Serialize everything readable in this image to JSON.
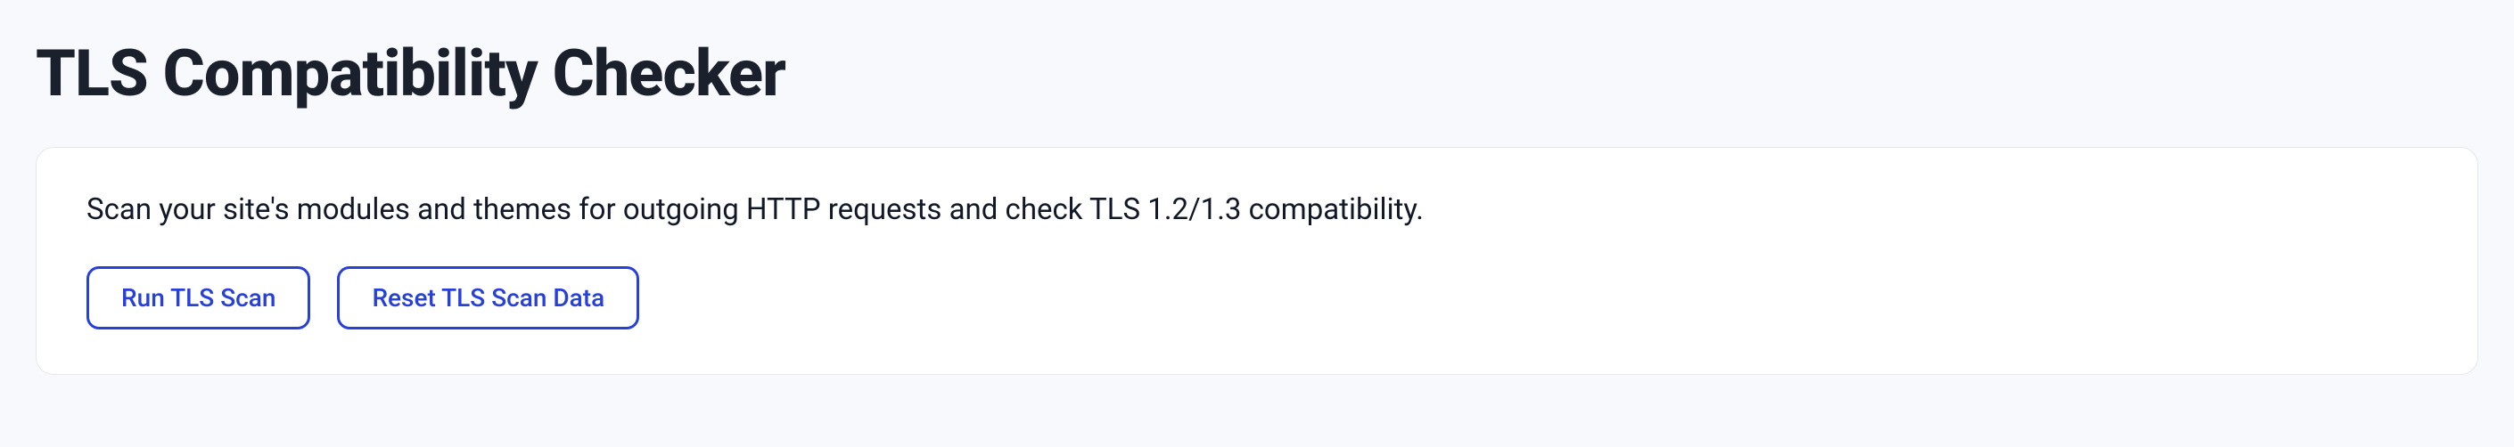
{
  "page": {
    "title": "TLS Compatibility Checker"
  },
  "card": {
    "description": "Scan your site's modules and themes for outgoing HTTP requests and check TLS 1.2/1.3 compatibility.",
    "buttons": {
      "run_scan": "Run TLS Scan",
      "reset_data": "Reset TLS Scan Data"
    }
  }
}
